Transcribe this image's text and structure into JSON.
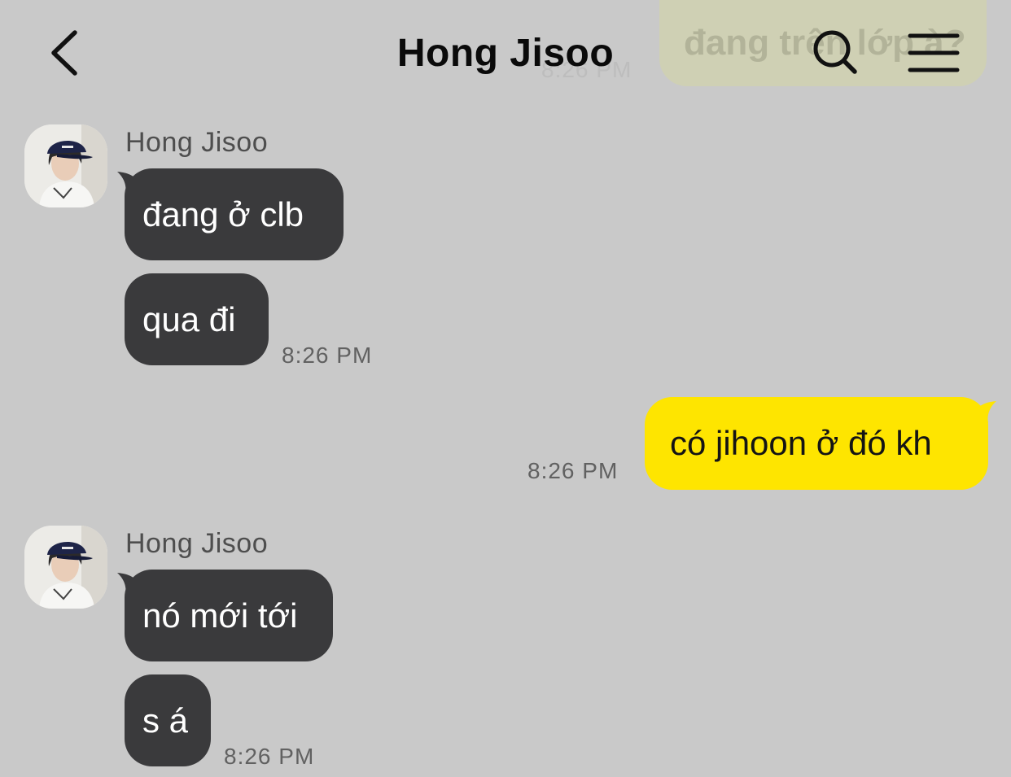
{
  "previous_message": {
    "text": "đang trên lớp à?",
    "time": "8:26 PM"
  },
  "header": {
    "title": "Hong Jisoo",
    "back_icon": "chevron-left-icon",
    "search_icon": "search-icon",
    "menu_icon": "hamburger-menu-icon"
  },
  "colors": {
    "background": "#c9c9c9",
    "incoming_bubble": "#3a3a3c",
    "outgoing_bubble": "#fee500"
  },
  "messages": [
    {
      "direction": "incoming",
      "sender": "Hong Jisoo",
      "bubbles": [
        "đang ở clb",
        "qua đi"
      ],
      "time": "8:26 PM"
    },
    {
      "direction": "outgoing",
      "bubbles": [
        "có jihoon ở đó kh"
      ],
      "time": "8:26 PM"
    },
    {
      "direction": "incoming",
      "sender": "Hong Jisoo",
      "bubbles": [
        "nó mới tới",
        "s á"
      ],
      "time": "8:26 PM"
    }
  ]
}
